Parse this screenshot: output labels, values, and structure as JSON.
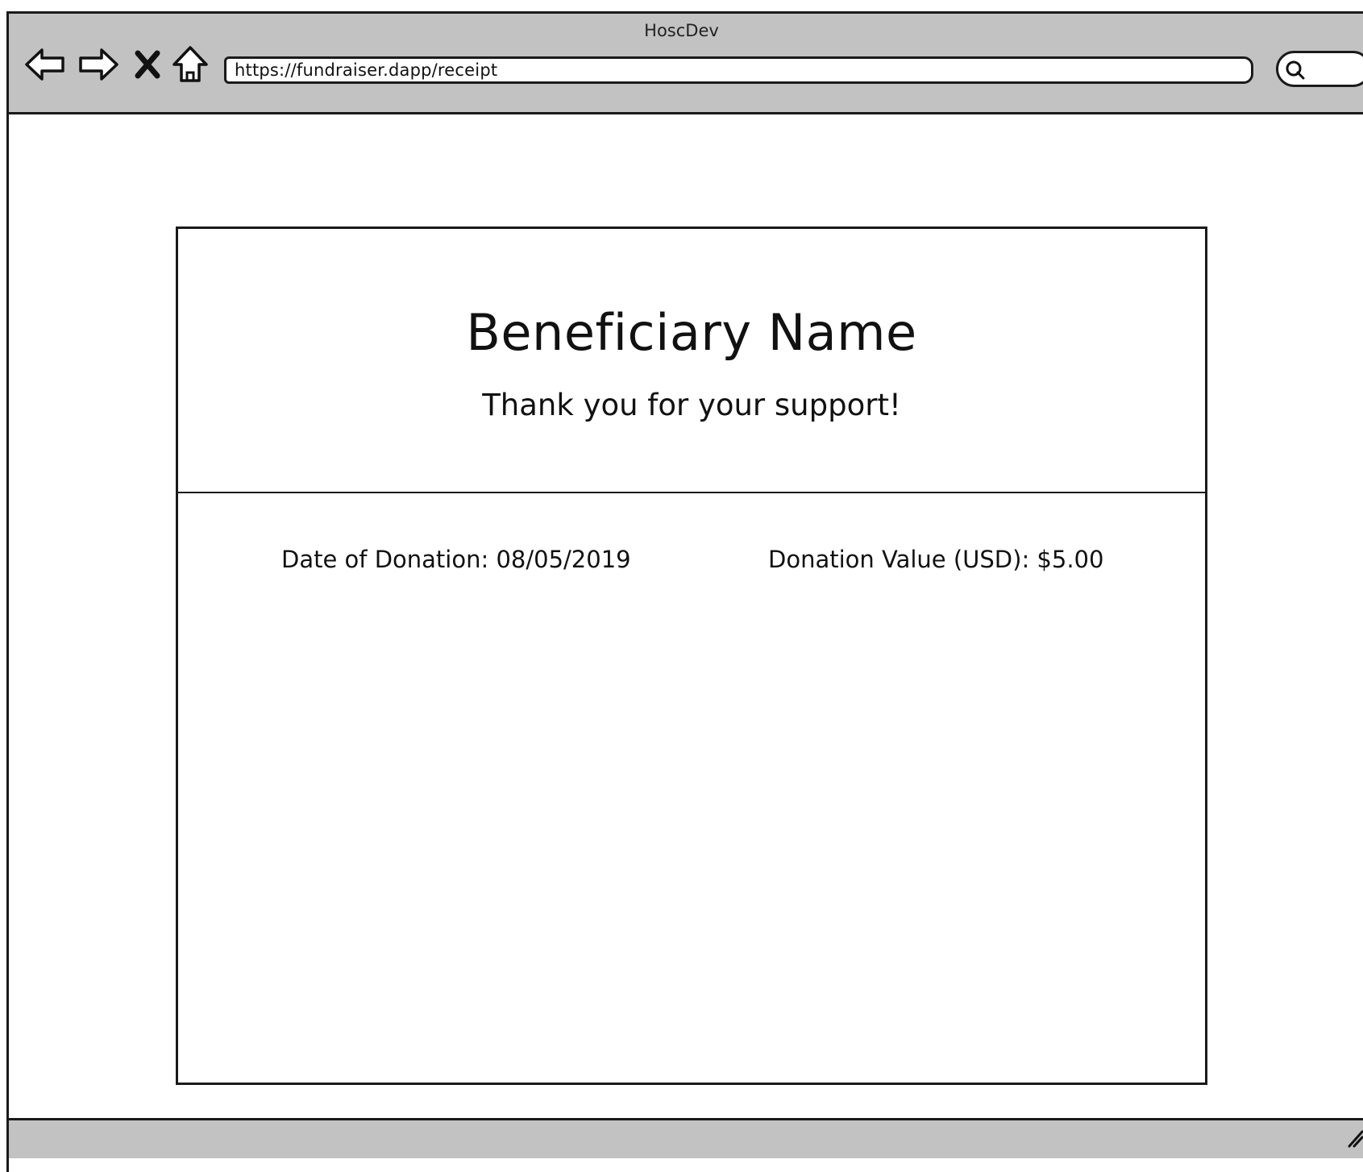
{
  "browser": {
    "title": "HoscDev",
    "url": "https://fundraiser.dapp/receipt"
  },
  "receipt": {
    "beneficiary_name": "Beneficiary Name",
    "thank_you": "Thank you for your support!",
    "date_of_donation": "Date of Donation: 08/05/2019",
    "donation_value": "Donation Value (USD): $5.00"
  },
  "icons": {
    "back": "back-arrow-icon",
    "forward": "forward-arrow-icon",
    "stop": "close-icon",
    "home": "home-icon",
    "search": "search-icon",
    "resize": "resize-grip-icon"
  },
  "colors": {
    "chrome": "#c2c2c2",
    "border": "#1a1a1a",
    "background": "#ffffff"
  }
}
